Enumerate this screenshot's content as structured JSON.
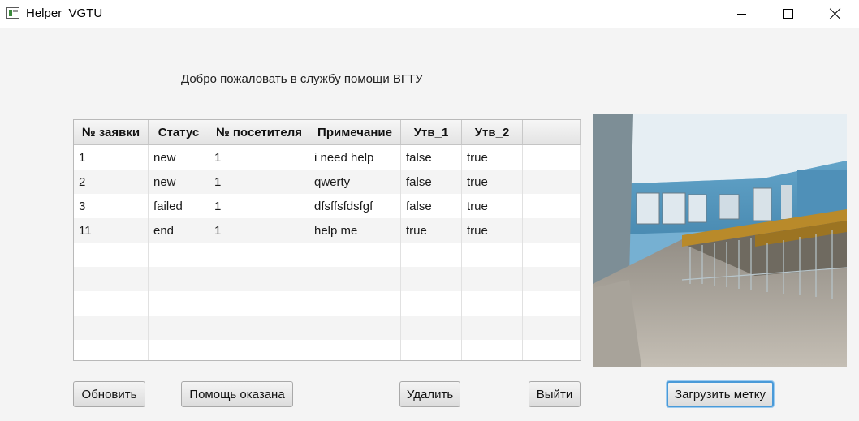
{
  "window": {
    "title": "Helper_VGTU",
    "app_icon": "java-window-icon",
    "controls": [
      "minimize-icon",
      "maximize-icon",
      "close-icon"
    ]
  },
  "main": {
    "welcome_text": "Добро пожаловать в службу помощи ВГТУ"
  },
  "table": {
    "headers": [
      "№ заявки",
      "Статус",
      "№ посетителя",
      "Примечание",
      "Утв_1",
      "Утв_2",
      ""
    ],
    "rows": [
      [
        "1",
        "new",
        "1",
        "i need help",
        "false",
        "true",
        ""
      ],
      [
        "2",
        "new",
        "1",
        "qwerty",
        "false",
        "true",
        ""
      ],
      [
        "3",
        "failed",
        "1",
        "dfsffsfdsfgf",
        "false",
        "true",
        ""
      ],
      [
        "11",
        "end",
        "1",
        "help me",
        "true",
        "true",
        ""
      ],
      [
        "",
        "",
        "",
        "",
        "",
        "",
        ""
      ],
      [
        "",
        "",
        "",
        "",
        "",
        "",
        ""
      ],
      [
        "",
        "",
        "",
        "",
        "",
        "",
        ""
      ],
      [
        "",
        "",
        "",
        "",
        "",
        "",
        ""
      ],
      [
        "",
        "",
        "",
        "",
        "",
        "",
        ""
      ]
    ]
  },
  "image": {
    "content": "university-hallway-photo"
  },
  "buttons": {
    "refresh": "Обновить",
    "help_done": "Помощь оказана",
    "delete": "Удалить",
    "exit": "Выйти",
    "upload_mark": "Загрузить метку"
  },
  "colors": {
    "window_bg": "#f4f4f4",
    "focus_ring": "#4a9ad8",
    "table_alt_row": "#f4f4f4"
  }
}
